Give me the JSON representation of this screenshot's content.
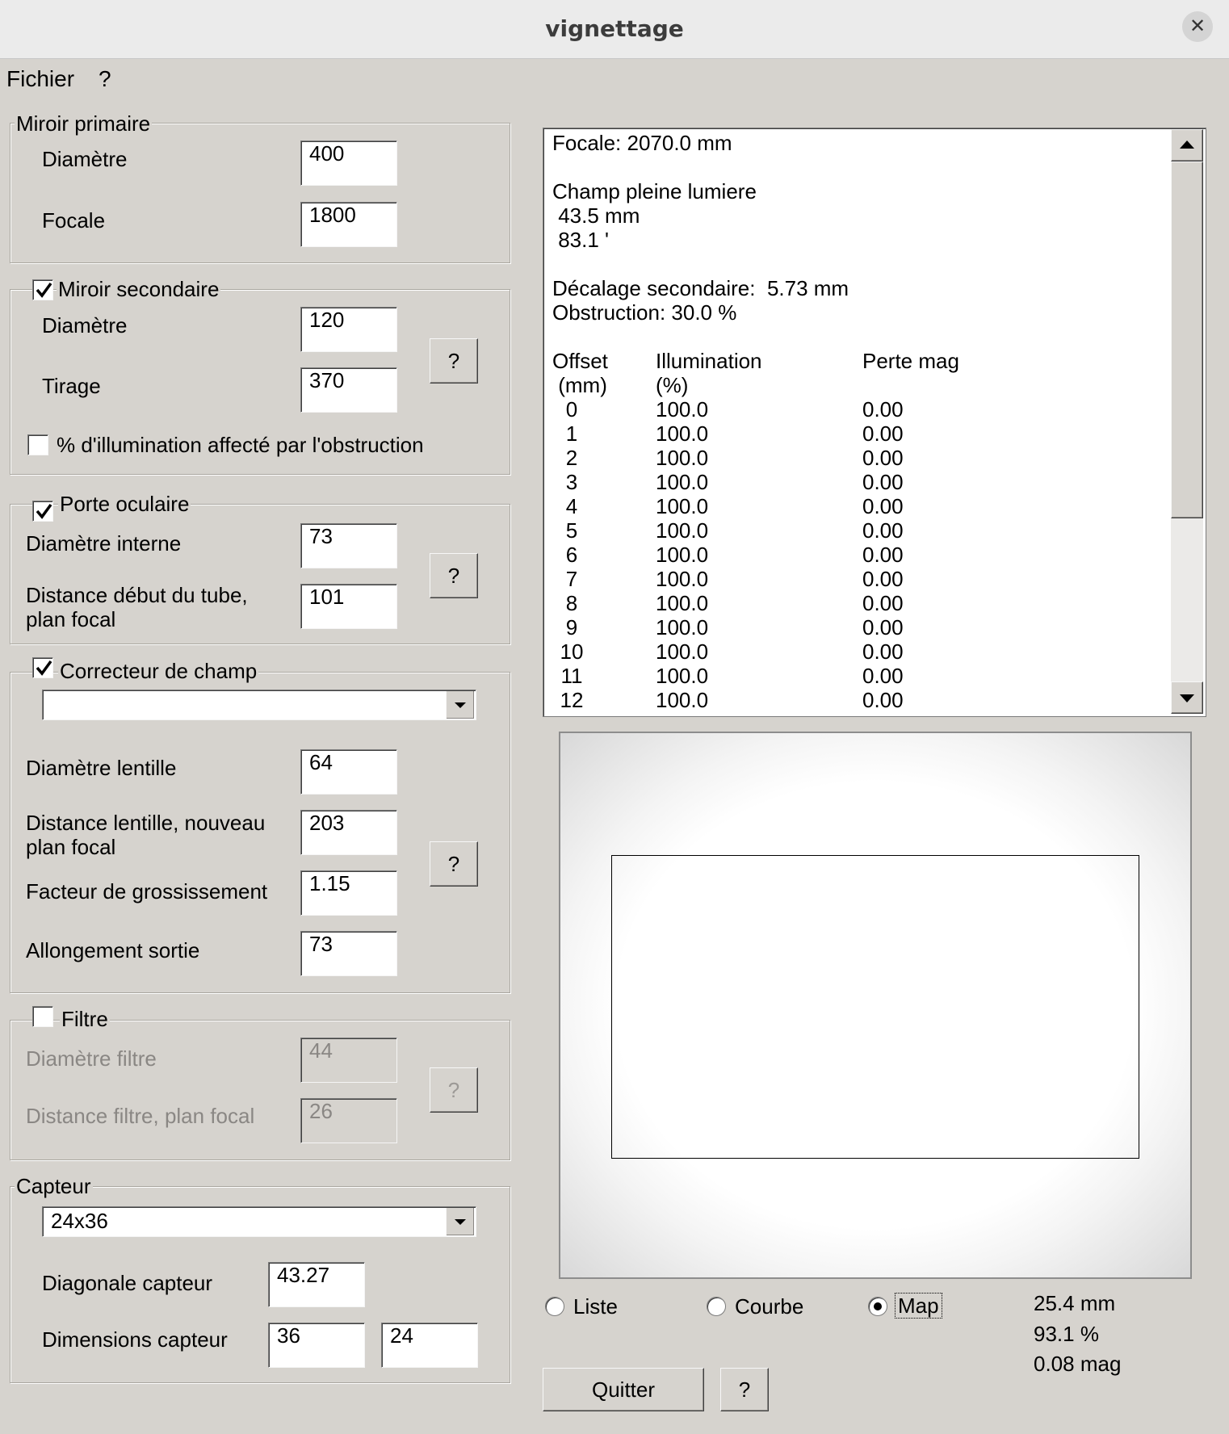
{
  "window": {
    "title": "vignettage",
    "close_glyph": "✕"
  },
  "menu": {
    "file": "Fichier",
    "help": "?"
  },
  "primary": {
    "legend": "Miroir primaire",
    "diameter_label": "Diamètre",
    "diameter": "400",
    "focal_label": "Focale",
    "focal": "1800"
  },
  "secondary": {
    "legend": "Miroir secondaire",
    "checked": true,
    "diameter_label": "Diamètre",
    "diameter": "120",
    "draw_label": "Tirage",
    "draw": "370",
    "help": "?",
    "obstruction_label": "% d'illumination affecté par l'obstruction",
    "obstruction_checked": false
  },
  "focuser": {
    "legend": "Porte oculaire",
    "checked": true,
    "inner_label": "Diamètre interne",
    "inner": "73",
    "dist_label_1": "Distance début du tube,",
    "dist_label_2": "plan focal",
    "dist": "101",
    "help": "?"
  },
  "corrector": {
    "legend": "Correcteur de champ",
    "checked": true,
    "combo_value": "",
    "lens_label": "Diamètre lentille",
    "lens": "64",
    "lensdist_label_1": "Distance lentille, nouveau",
    "lensdist_label_2": "plan focal",
    "lensdist": "203",
    "mag_label": "Facteur de grossissement",
    "mag": "1.15",
    "ext_label": "Allongement sortie",
    "ext": "73",
    "help": "?"
  },
  "filter": {
    "legend": "Filtre",
    "checked": false,
    "diam_label": "Diamètre filtre",
    "diam": "44",
    "dist_label": "Distance filtre, plan focal",
    "dist": "26",
    "help": "?"
  },
  "sensor": {
    "legend": "Capteur",
    "combo_value": "24x36",
    "diag_label": "Diagonale capteur",
    "diag": "43.27",
    "dim_label": "Dimensions capteur",
    "width": "36",
    "height": "24"
  },
  "output": {
    "focal": "Focale: 2070.0 mm",
    "field_title": "Champ pleine lumiere",
    "field_mm": " 43.5 mm",
    "field_arcmin": " 83.1 '",
    "offset_line": "Décalage secondaire:  5.73 mm",
    "obstruction_line": "Obstruction: 30.0 %",
    "headers": [
      "Offset",
      "Illumination",
      "Perte mag"
    ],
    "units": [
      " (mm)",
      "(%)",
      ""
    ],
    "rows": [
      [
        "0",
        "100.0",
        "0.00"
      ],
      [
        "1",
        "100.0",
        "0.00"
      ],
      [
        "2",
        "100.0",
        "0.00"
      ],
      [
        "3",
        "100.0",
        "0.00"
      ],
      [
        "4",
        "100.0",
        "0.00"
      ],
      [
        "5",
        "100.0",
        "0.00"
      ],
      [
        "6",
        "100.0",
        "0.00"
      ],
      [
        "7",
        "100.0",
        "0.00"
      ],
      [
        "8",
        "100.0",
        "0.00"
      ],
      [
        "9",
        "100.0",
        "0.00"
      ],
      [
        "10",
        "100.0",
        "0.00"
      ],
      [
        "11",
        "100.0",
        "0.00"
      ],
      [
        "12",
        "100.0",
        "0.00"
      ]
    ]
  },
  "view": {
    "list": "Liste",
    "curve": "Courbe",
    "map": "Map",
    "selected": "Map"
  },
  "readout": {
    "mm": "25.4 mm",
    "percent": "93.1 %",
    "mag": "0.08 mag"
  },
  "footer": {
    "quit": "Quitter",
    "help": "?"
  }
}
